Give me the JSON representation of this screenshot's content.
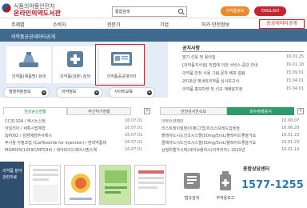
{
  "header": {
    "org_top": "식품의약품안전처",
    "org_name": "온라인의약도서관",
    "search_value": "통합검색",
    "link_drug_info": "의약품정보",
    "link_lang": "ENGLISH"
  },
  "nav": {
    "items": [
      "주제별",
      "소비자",
      "전문가",
      "기업",
      "허가·안전정보",
      "공공데이터공개"
    ]
  },
  "banner": {
    "title": "의약품공공데이터공개"
  },
  "quick": {
    "buttons": [
      {
        "label": "의약품(제품명) 검색",
        "icon": "pill-bottle-icon"
      },
      {
        "label": "의약품(성분) 검색",
        "icon": "medical-cross-icon"
      },
      {
        "label": "의약품공공데이터",
        "icon": "data-screen-icon"
      }
    ],
    "sub_buttons": [
      "행정처분정보",
      "의약정보",
      "사이버교육"
    ]
  },
  "notice": {
    "title": "공지사항",
    "rows": [
      {
        "title": "발기 선웅 및 용어집",
        "date": "16.01.25"
      },
      {
        "title": "[의약품지식검] 직접에 의한 서비스 중단 안내",
        "date": "16.01.18"
      },
      {
        "title": "의약품 안전 사용 그림 문자 배포 알림",
        "date": "15.09.01"
      },
      {
        "title": "2016년 제네릭의약품 심사보고서",
        "date": "15.04.01"
      },
      {
        "title": "의약품 홍보마켓 및 선교 재배달지정",
        "date": "15.04.01"
      }
    ]
  },
  "left_panel": {
    "tabs": [
      "임상승인현황",
      "주간허가현황"
    ],
    "rows": [
      {
        "title": "CC3110A / 엑시노신정",
        "date": "16.07.01"
      },
      {
        "title": "아일리아 / 세툭시맙제형",
        "date": "16.07.01"
      },
      {
        "title": "SJP002 / 감염예방주사제시",
        "date": "16.07.01"
      },
      {
        "title": "주사용 카필조밉 (Carfilzomib for Injection) / 현대약품제",
        "date": "16.07.01"
      },
      {
        "title": "MG800S(1359C/MT034) / 데아보이드에이시퀀스제",
        "date": "16.07.01"
      }
    ]
  },
  "right_panel": {
    "tabs": [
      "안전성서한속보",
      "회수판매중지"
    ],
    "rows": [
      {
        "title": "이부스코레이",
        "date": "16.06.07"
      },
      {
        "title": "리스트레이빌정(이제)그립(미소스프레드집을정",
        "date": "16.06.20"
      },
      {
        "title": "플레아드시드건조시스렐(50mg/5mL)플레아드좋을거요",
        "date": "16.01.23"
      },
      {
        "title": "클레아드시드건조시스렐(50mg/5mL)플레아드좋을거요",
        "date": "16.01.23"
      },
      {
        "title": "상정미엘가시렉(세이브플러스(의약리아), 2015년",
        "date": "16.01.19"
      }
    ]
  },
  "bottom": {
    "side_lines": [
      "의약품 분야",
      "관련자료"
    ],
    "widgets": [
      "법규검색",
      "부작용보고"
    ],
    "center_title": "종합상담센터",
    "phone": "1577-1255"
  },
  "colors": {
    "brand_red": "#c4141a",
    "nav_blue": "#3f6a8f",
    "highlight_red": "#dd2222",
    "tab_green": "#2d9a6a"
  }
}
